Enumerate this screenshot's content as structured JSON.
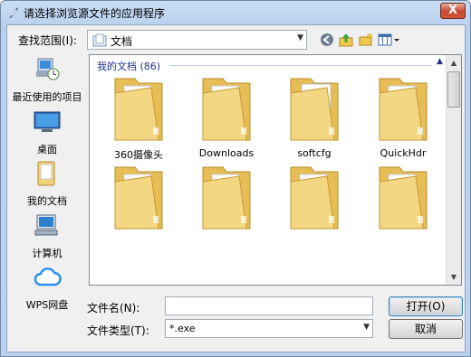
{
  "window": {
    "title": "请选择浏览源文件的应用程序",
    "close_label": "X"
  },
  "lookin": {
    "label": "查找范围(I):",
    "value": "文档"
  },
  "places": [
    {
      "label": "最近使用的项目",
      "icon": "recent-items-icon"
    },
    {
      "label": "桌面",
      "icon": "desktop-icon"
    },
    {
      "label": "我的文档",
      "icon": "documents-icon"
    },
    {
      "label": "计算机",
      "icon": "computer-icon"
    },
    {
      "label": "WPS网盘",
      "icon": "cloud-drive-icon"
    }
  ],
  "files": {
    "group_header": "我的文档 (86)",
    "items": [
      {
        "label": "360摄像头",
        "icon": "folder-icon"
      },
      {
        "label": "Downloads",
        "icon": "folder-icon"
      },
      {
        "label": "softcfg",
        "icon": "folder-settings-icon"
      },
      {
        "label": "QuickHdr",
        "icon": "folder-icon"
      },
      {
        "label": "",
        "icon": "folder-icon"
      },
      {
        "label": "",
        "icon": "folder-icon"
      },
      {
        "label": "",
        "icon": "folder-icon"
      },
      {
        "label": "",
        "icon": "folder-icon"
      }
    ]
  },
  "filename": {
    "label": "文件名(N):",
    "value": ""
  },
  "filetype": {
    "label": "文件类型(T):",
    "value": "*.exe"
  },
  "buttons": {
    "open": "打开(O)",
    "cancel": "取消"
  },
  "colors": {
    "title_bar": "#bcd2ef",
    "close_button": "#c7462f",
    "folder": "#f2d27a",
    "group_header": "#1e3287"
  }
}
